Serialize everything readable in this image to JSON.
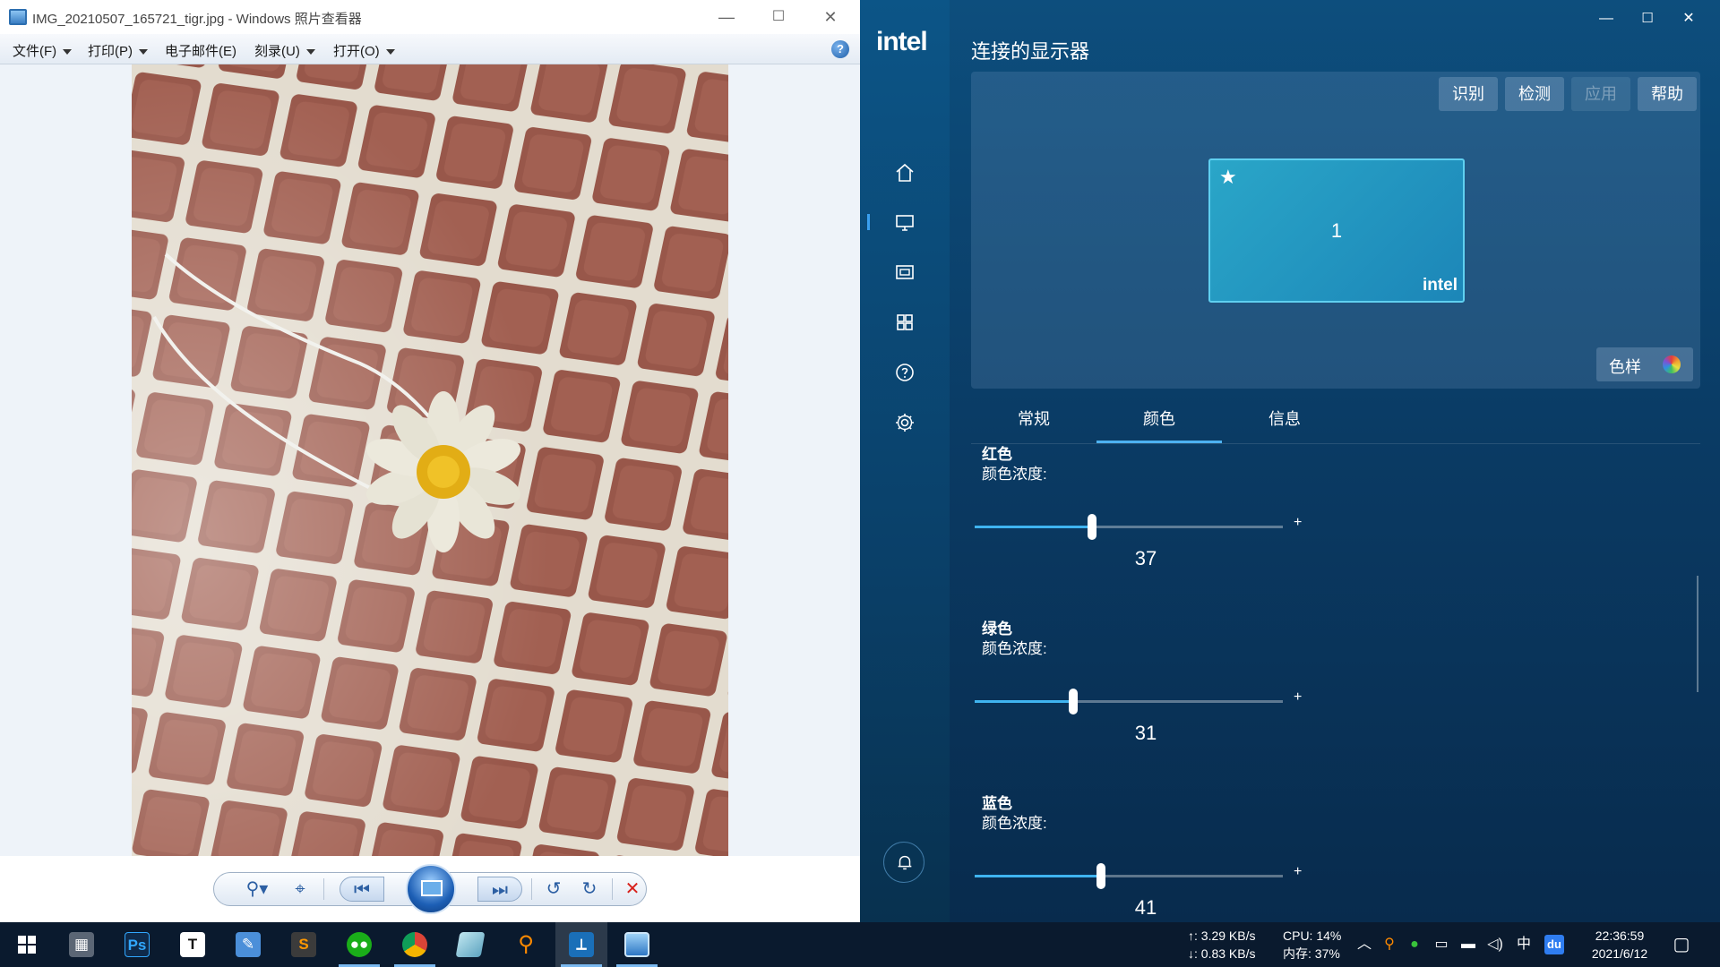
{
  "photo_viewer": {
    "title": "IMG_20210507_165721_tigr.jpg - Windows 照片查看器",
    "menu": [
      "文件(F)",
      "打印(P)",
      "电子邮件(E)",
      "刻录(U)",
      "打开(O)"
    ],
    "help": "?",
    "window_buttons": {
      "minimize": "—",
      "maximize": "☐",
      "close": "✕"
    },
    "toolbar_icons": [
      "zoom-icon",
      "fit-window-icon",
      "previous-icon",
      "slideshow-icon",
      "next-icon",
      "rotate-left-icon",
      "rotate-right-icon",
      "delete-icon"
    ]
  },
  "intel": {
    "logo": "intel",
    "page_title": "连接的显示器",
    "window_buttons": {
      "minimize": "—",
      "maximize": "☐",
      "close": "✕"
    },
    "actions": {
      "identify": "识别",
      "detect": "检测",
      "apply": "应用",
      "help": "帮助"
    },
    "monitor": {
      "star": "★",
      "number": "1",
      "brand": "intel"
    },
    "swatch_label": "色样",
    "tabs": [
      "常规",
      "颜色",
      "信息"
    ],
    "active_tab": "颜色",
    "colors": [
      {
        "name": "红色",
        "label": "颜色浓度:",
        "value": "37",
        "level_pct": 38
      },
      {
        "name": "绿色",
        "label": "颜色浓度:",
        "value": "31",
        "level_pct": 32
      },
      {
        "name": "蓝色",
        "label": "颜色浓度:",
        "value": "41",
        "level_pct": 41
      }
    ],
    "slider_minus": "-",
    "slider_plus": "+",
    "sidebar_icons": [
      "home-icon",
      "display-icon",
      "video-icon",
      "apps-icon",
      "help-icon",
      "settings-icon"
    ],
    "bell_icon": "bell-icon",
    "accent_color": "#3fb4f0"
  },
  "taskbar": {
    "apps": [
      "start-icon",
      "calculator-icon",
      "photoshop-icon",
      "typora-icon",
      "notepad-icon",
      "sublime-icon",
      "wechat-icon",
      "chrome-icon",
      "hash-icon",
      "search-app-icon",
      "intel-graphics-icon",
      "photo-viewer-icon"
    ],
    "app_glyphs": {
      "photoshop": "Ps",
      "typora": "T"
    },
    "net_up": "↑: 3.29 KB/s",
    "net_down": "↓: 0.83 KB/s",
    "cpu": "CPU: 14%",
    "mem": "内存: 37%",
    "ime": "中",
    "baidu": "du",
    "time": "22:36:59",
    "date": "2021/6/12"
  }
}
